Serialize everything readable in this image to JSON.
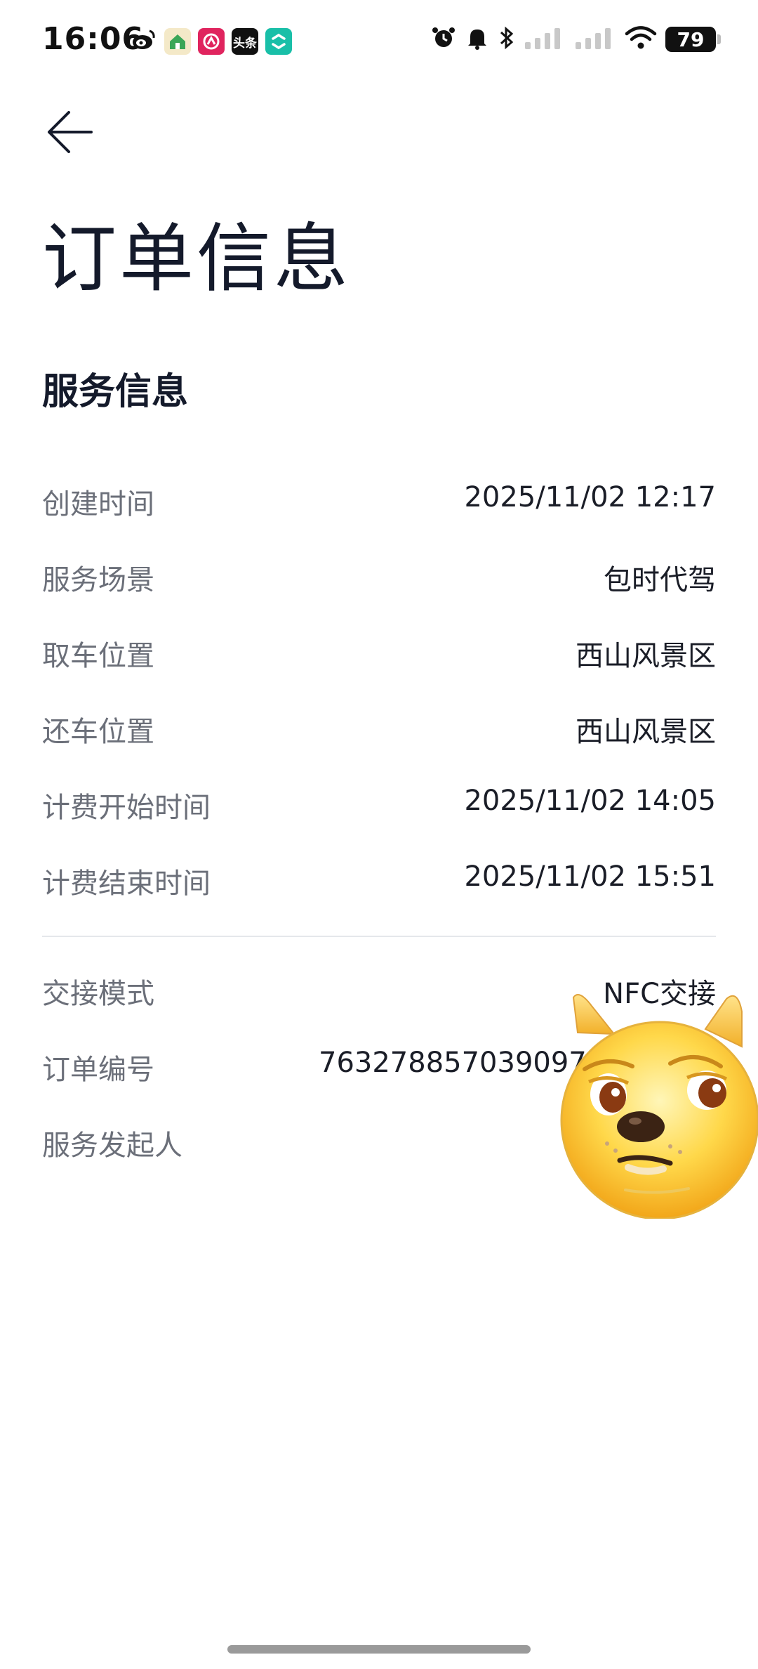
{
  "status_bar": {
    "time": "16:06",
    "battery": "79",
    "app_icons": [
      "weibo-icon",
      "home-app-icon",
      "red-app-icon",
      "toutiao-icon",
      "teal-app-icon"
    ],
    "toutiao_label": "头条"
  },
  "header": {
    "title": "订单信息"
  },
  "service_section": {
    "title": "服务信息",
    "rows": [
      {
        "label": "创建时间",
        "value": "2025/11/02 12:17"
      },
      {
        "label": "服务场景",
        "value": "包时代驾"
      },
      {
        "label": "取车位置",
        "value": "西山风景区"
      },
      {
        "label": "还车位置",
        "value": "西山风景区"
      },
      {
        "label": "计费开始时间",
        "value": "2025/11/02 14:05"
      },
      {
        "label": "计费结束时间",
        "value": "2025/11/02 15:51"
      }
    ]
  },
  "extra_section": {
    "rows": [
      {
        "label": "交接模式",
        "value": "NFC交接"
      },
      {
        "label": "订单编号",
        "value": "763278857039097"
      },
      {
        "label": "服务发起人",
        "value": ""
      }
    ]
  },
  "colors": {
    "title": "#141a2b",
    "label": "#6b6f79",
    "value": "#1a1d27",
    "divider": "#e5e7eb"
  }
}
